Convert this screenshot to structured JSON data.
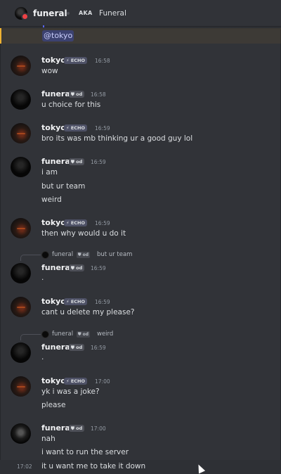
{
  "header": {
    "name": "funeral",
    "aka_label": "AKA",
    "alias": "Funeral"
  },
  "mention": "@tokyo",
  "badges": {
    "echo": "ECHO",
    "od": "od"
  },
  "messages": [
    {
      "author": "tokyo",
      "time": "16:58",
      "lines": [
        "wow"
      ]
    },
    {
      "author": "funeral",
      "time": "16:58",
      "lines": [
        "u choice for this"
      ]
    },
    {
      "author": "tokyo",
      "time": "16:59",
      "lines": [
        "bro its was mb thinking ur a good guy lol"
      ]
    },
    {
      "author": "funeral",
      "time": "16:59",
      "lines": [
        "i am",
        "but ur team",
        "weird"
      ]
    },
    {
      "author": "tokyo",
      "time": "16:59",
      "lines": [
        "then why would u do it"
      ]
    },
    {
      "author": "funeral",
      "time": "16:59",
      "lines": [
        "."
      ],
      "reply": {
        "author": "funeral",
        "text": "but ur team"
      }
    },
    {
      "author": "tokyo",
      "time": "16:59",
      "lines": [
        "cant u delete my please?"
      ]
    },
    {
      "author": "funeral",
      "time": "16:59",
      "lines": [
        "."
      ],
      "reply": {
        "author": "funeral",
        "text": "weird"
      }
    },
    {
      "author": "tokyo",
      "time": "17:00",
      "lines": [
        "yk i was a joke?",
        "please"
      ]
    },
    {
      "author": "funeral",
      "time": "17:00",
      "lines": [
        "nah",
        "i want to run the server"
      ]
    }
  ],
  "continuation": {
    "time": "17:02",
    "text": "it u want me to take it down"
  },
  "icons": {
    "badge_tokyo": "wand-icon",
    "badge_funeral": "shield-icon",
    "cursor": "mouse-pointer-icon"
  },
  "colors": {
    "background": "#313338",
    "mention_bg": "#3c4270",
    "highlight_bar": "#f0b232"
  }
}
